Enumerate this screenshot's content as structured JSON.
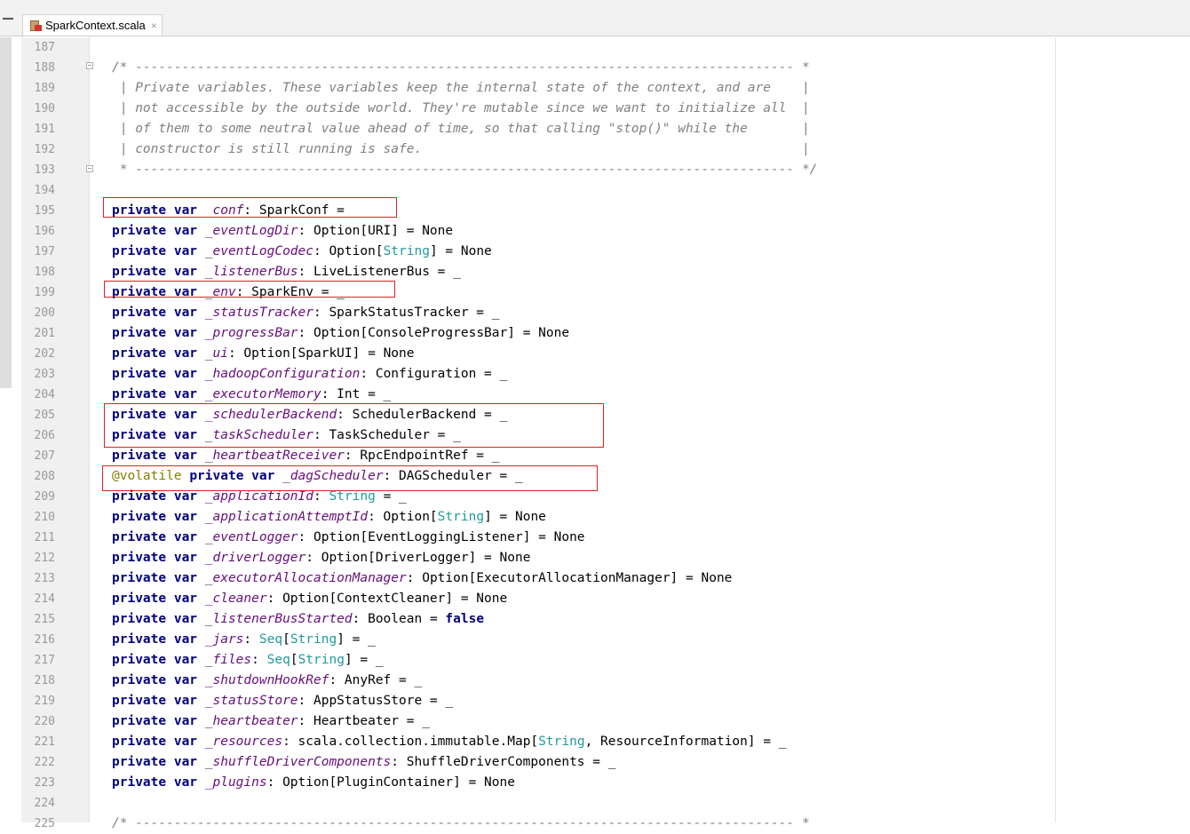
{
  "tab": {
    "title": "SparkContext.scala",
    "close": "×"
  },
  "lines": [
    {
      "n": "187",
      "parts": []
    },
    {
      "n": "188",
      "parts": [
        {
          "t": "/* ------------------------------------------------------------------------------------- *",
          "c": "cmt"
        }
      ]
    },
    {
      "n": "189",
      "parts": [
        {
          "t": " | Private variables. These variables keep the internal state of the context, and are    |",
          "c": "cmt"
        }
      ]
    },
    {
      "n": "190",
      "parts": [
        {
          "t": " | not accessible by the outside world. They're mutable since we want to initialize all  |",
          "c": "cmt"
        }
      ]
    },
    {
      "n": "191",
      "parts": [
        {
          "t": " | of them to some neutral value ahead of time, so that calling \"stop()\" while the       |",
          "c": "cmt"
        }
      ]
    },
    {
      "n": "192",
      "parts": [
        {
          "t": " | constructor is still running is safe.                                                 |",
          "c": "cmt"
        }
      ]
    },
    {
      "n": "193",
      "parts": [
        {
          "t": " * ------------------------------------------------------------------------------------- */",
          "c": "cmt"
        }
      ]
    },
    {
      "n": "194",
      "parts": []
    },
    {
      "n": "195",
      "parts": [
        {
          "t": "private var ",
          "c": "kw"
        },
        {
          "t": "_conf",
          "c": "fld"
        },
        {
          "t": ": SparkConf = _",
          "c": ""
        }
      ]
    },
    {
      "n": "196",
      "parts": [
        {
          "t": "private var ",
          "c": "kw"
        },
        {
          "t": "_eventLogDir",
          "c": "fld"
        },
        {
          "t": ": Option[URI] = None",
          "c": ""
        }
      ]
    },
    {
      "n": "197",
      "parts": [
        {
          "t": "private var ",
          "c": "kw"
        },
        {
          "t": "_eventLogCodec",
          "c": "fld"
        },
        {
          "t": ": Option[",
          "c": ""
        },
        {
          "t": "String",
          "c": "typ"
        },
        {
          "t": "] = None",
          "c": ""
        }
      ]
    },
    {
      "n": "198",
      "parts": [
        {
          "t": "private var ",
          "c": "kw"
        },
        {
          "t": "_listenerBus",
          "c": "fld"
        },
        {
          "t": ": LiveListenerBus = _",
          "c": ""
        }
      ]
    },
    {
      "n": "199",
      "parts": [
        {
          "t": "private var ",
          "c": "kw"
        },
        {
          "t": "_env",
          "c": "fld"
        },
        {
          "t": ": SparkEnv = _",
          "c": ""
        }
      ]
    },
    {
      "n": "200",
      "parts": [
        {
          "t": "private var ",
          "c": "kw"
        },
        {
          "t": "_statusTracker",
          "c": "fld"
        },
        {
          "t": ": SparkStatusTracker = _",
          "c": ""
        }
      ]
    },
    {
      "n": "201",
      "parts": [
        {
          "t": "private var ",
          "c": "kw"
        },
        {
          "t": "_progressBar",
          "c": "fld"
        },
        {
          "t": ": Option[ConsoleProgressBar] = None",
          "c": ""
        }
      ]
    },
    {
      "n": "202",
      "parts": [
        {
          "t": "private var ",
          "c": "kw"
        },
        {
          "t": "_ui",
          "c": "fld"
        },
        {
          "t": ": Option[SparkUI] = None",
          "c": ""
        }
      ]
    },
    {
      "n": "203",
      "parts": [
        {
          "t": "private var ",
          "c": "kw"
        },
        {
          "t": "_hadoopConfiguration",
          "c": "fld"
        },
        {
          "t": ": Configuration = _",
          "c": ""
        }
      ]
    },
    {
      "n": "204",
      "parts": [
        {
          "t": "private var ",
          "c": "kw"
        },
        {
          "t": "_executorMemory",
          "c": "fld"
        },
        {
          "t": ": Int = _",
          "c": ""
        }
      ]
    },
    {
      "n": "205",
      "parts": [
        {
          "t": "private var ",
          "c": "kw"
        },
        {
          "t": "_schedulerBackend",
          "c": "fld"
        },
        {
          "t": ": SchedulerBackend = _",
          "c": ""
        }
      ]
    },
    {
      "n": "206",
      "parts": [
        {
          "t": "private var ",
          "c": "kw"
        },
        {
          "t": "_taskScheduler",
          "c": "fld"
        },
        {
          "t": ": TaskScheduler = _",
          "c": ""
        }
      ]
    },
    {
      "n": "207",
      "parts": [
        {
          "t": "private var ",
          "c": "kw"
        },
        {
          "t": "_heartbeatReceiver",
          "c": "fld"
        },
        {
          "t": ": RpcEndpointRef = _",
          "c": ""
        }
      ]
    },
    {
      "n": "208",
      "parts": [
        {
          "t": "@volatile ",
          "c": "ann"
        },
        {
          "t": "private var ",
          "c": "kw"
        },
        {
          "t": "_dagScheduler",
          "c": "fld"
        },
        {
          "t": ": DAGScheduler = _",
          "c": ""
        }
      ]
    },
    {
      "n": "209",
      "parts": [
        {
          "t": "private var ",
          "c": "kw"
        },
        {
          "t": "_applicationId",
          "c": "fld"
        },
        {
          "t": ": ",
          "c": ""
        },
        {
          "t": "String",
          "c": "typ"
        },
        {
          "t": " = _",
          "c": ""
        }
      ]
    },
    {
      "n": "210",
      "parts": [
        {
          "t": "private var ",
          "c": "kw"
        },
        {
          "t": "_applicationAttemptId",
          "c": "fld"
        },
        {
          "t": ": Option[",
          "c": ""
        },
        {
          "t": "String",
          "c": "typ"
        },
        {
          "t": "] = None",
          "c": ""
        }
      ]
    },
    {
      "n": "211",
      "parts": [
        {
          "t": "private var ",
          "c": "kw"
        },
        {
          "t": "_eventLogger",
          "c": "fld"
        },
        {
          "t": ": Option[EventLoggingListener] = None",
          "c": ""
        }
      ]
    },
    {
      "n": "212",
      "parts": [
        {
          "t": "private var ",
          "c": "kw"
        },
        {
          "t": "_driverLogger",
          "c": "fld"
        },
        {
          "t": ": Option[DriverLogger] = None",
          "c": ""
        }
      ]
    },
    {
      "n": "213",
      "parts": [
        {
          "t": "private var ",
          "c": "kw"
        },
        {
          "t": "_executorAllocationManager",
          "c": "fld"
        },
        {
          "t": ": Option[ExecutorAllocationManager] = None",
          "c": ""
        }
      ]
    },
    {
      "n": "214",
      "parts": [
        {
          "t": "private var ",
          "c": "kw"
        },
        {
          "t": "_cleaner",
          "c": "fld"
        },
        {
          "t": ": Option[ContextCleaner] = None",
          "c": ""
        }
      ]
    },
    {
      "n": "215",
      "parts": [
        {
          "t": "private var ",
          "c": "kw"
        },
        {
          "t": "_listenerBusStarted",
          "c": "fld"
        },
        {
          "t": ": Boolean = ",
          "c": ""
        },
        {
          "t": "false",
          "c": "kw"
        }
      ]
    },
    {
      "n": "216",
      "parts": [
        {
          "t": "private var ",
          "c": "kw"
        },
        {
          "t": "_jars",
          "c": "fld"
        },
        {
          "t": ": ",
          "c": ""
        },
        {
          "t": "Seq",
          "c": "typ"
        },
        {
          "t": "[",
          "c": ""
        },
        {
          "t": "String",
          "c": "typ"
        },
        {
          "t": "] = _",
          "c": ""
        }
      ]
    },
    {
      "n": "217",
      "parts": [
        {
          "t": "private var ",
          "c": "kw"
        },
        {
          "t": "_files",
          "c": "fld"
        },
        {
          "t": ": ",
          "c": ""
        },
        {
          "t": "Seq",
          "c": "typ"
        },
        {
          "t": "[",
          "c": ""
        },
        {
          "t": "String",
          "c": "typ"
        },
        {
          "t": "] = _",
          "c": ""
        }
      ]
    },
    {
      "n": "218",
      "parts": [
        {
          "t": "private var ",
          "c": "kw"
        },
        {
          "t": "_shutdownHookRef",
          "c": "fld"
        },
        {
          "t": ": AnyRef = _",
          "c": ""
        }
      ]
    },
    {
      "n": "219",
      "parts": [
        {
          "t": "private var ",
          "c": "kw"
        },
        {
          "t": "_statusStore",
          "c": "fld"
        },
        {
          "t": ": AppStatusStore = _",
          "c": ""
        }
      ]
    },
    {
      "n": "220",
      "parts": [
        {
          "t": "private var ",
          "c": "kw"
        },
        {
          "t": "_heartbeater",
          "c": "fld"
        },
        {
          "t": ": Heartbeater = _",
          "c": ""
        }
      ]
    },
    {
      "n": "221",
      "parts": [
        {
          "t": "private var ",
          "c": "kw"
        },
        {
          "t": "_resources",
          "c": "fld"
        },
        {
          "t": ": scala.collection.immutable.Map[",
          "c": ""
        },
        {
          "t": "String",
          "c": "typ"
        },
        {
          "t": ", ResourceInformation] = _",
          "c": ""
        }
      ]
    },
    {
      "n": "222",
      "parts": [
        {
          "t": "private var ",
          "c": "kw"
        },
        {
          "t": "_shuffleDriverComponents",
          "c": "fld"
        },
        {
          "t": ": ShuffleDriverComponents = _",
          "c": ""
        }
      ]
    },
    {
      "n": "223",
      "parts": [
        {
          "t": "private var ",
          "c": "kw"
        },
        {
          "t": "_plugins",
          "c": "fld"
        },
        {
          "t": ": Option[PluginContainer] = None",
          "c": ""
        }
      ]
    },
    {
      "n": "224",
      "parts": []
    },
    {
      "n": "225",
      "parts": [
        {
          "t": "/* ------------------------------------------------------------------------------------- *",
          "c": "cmt"
        }
      ]
    }
  ]
}
